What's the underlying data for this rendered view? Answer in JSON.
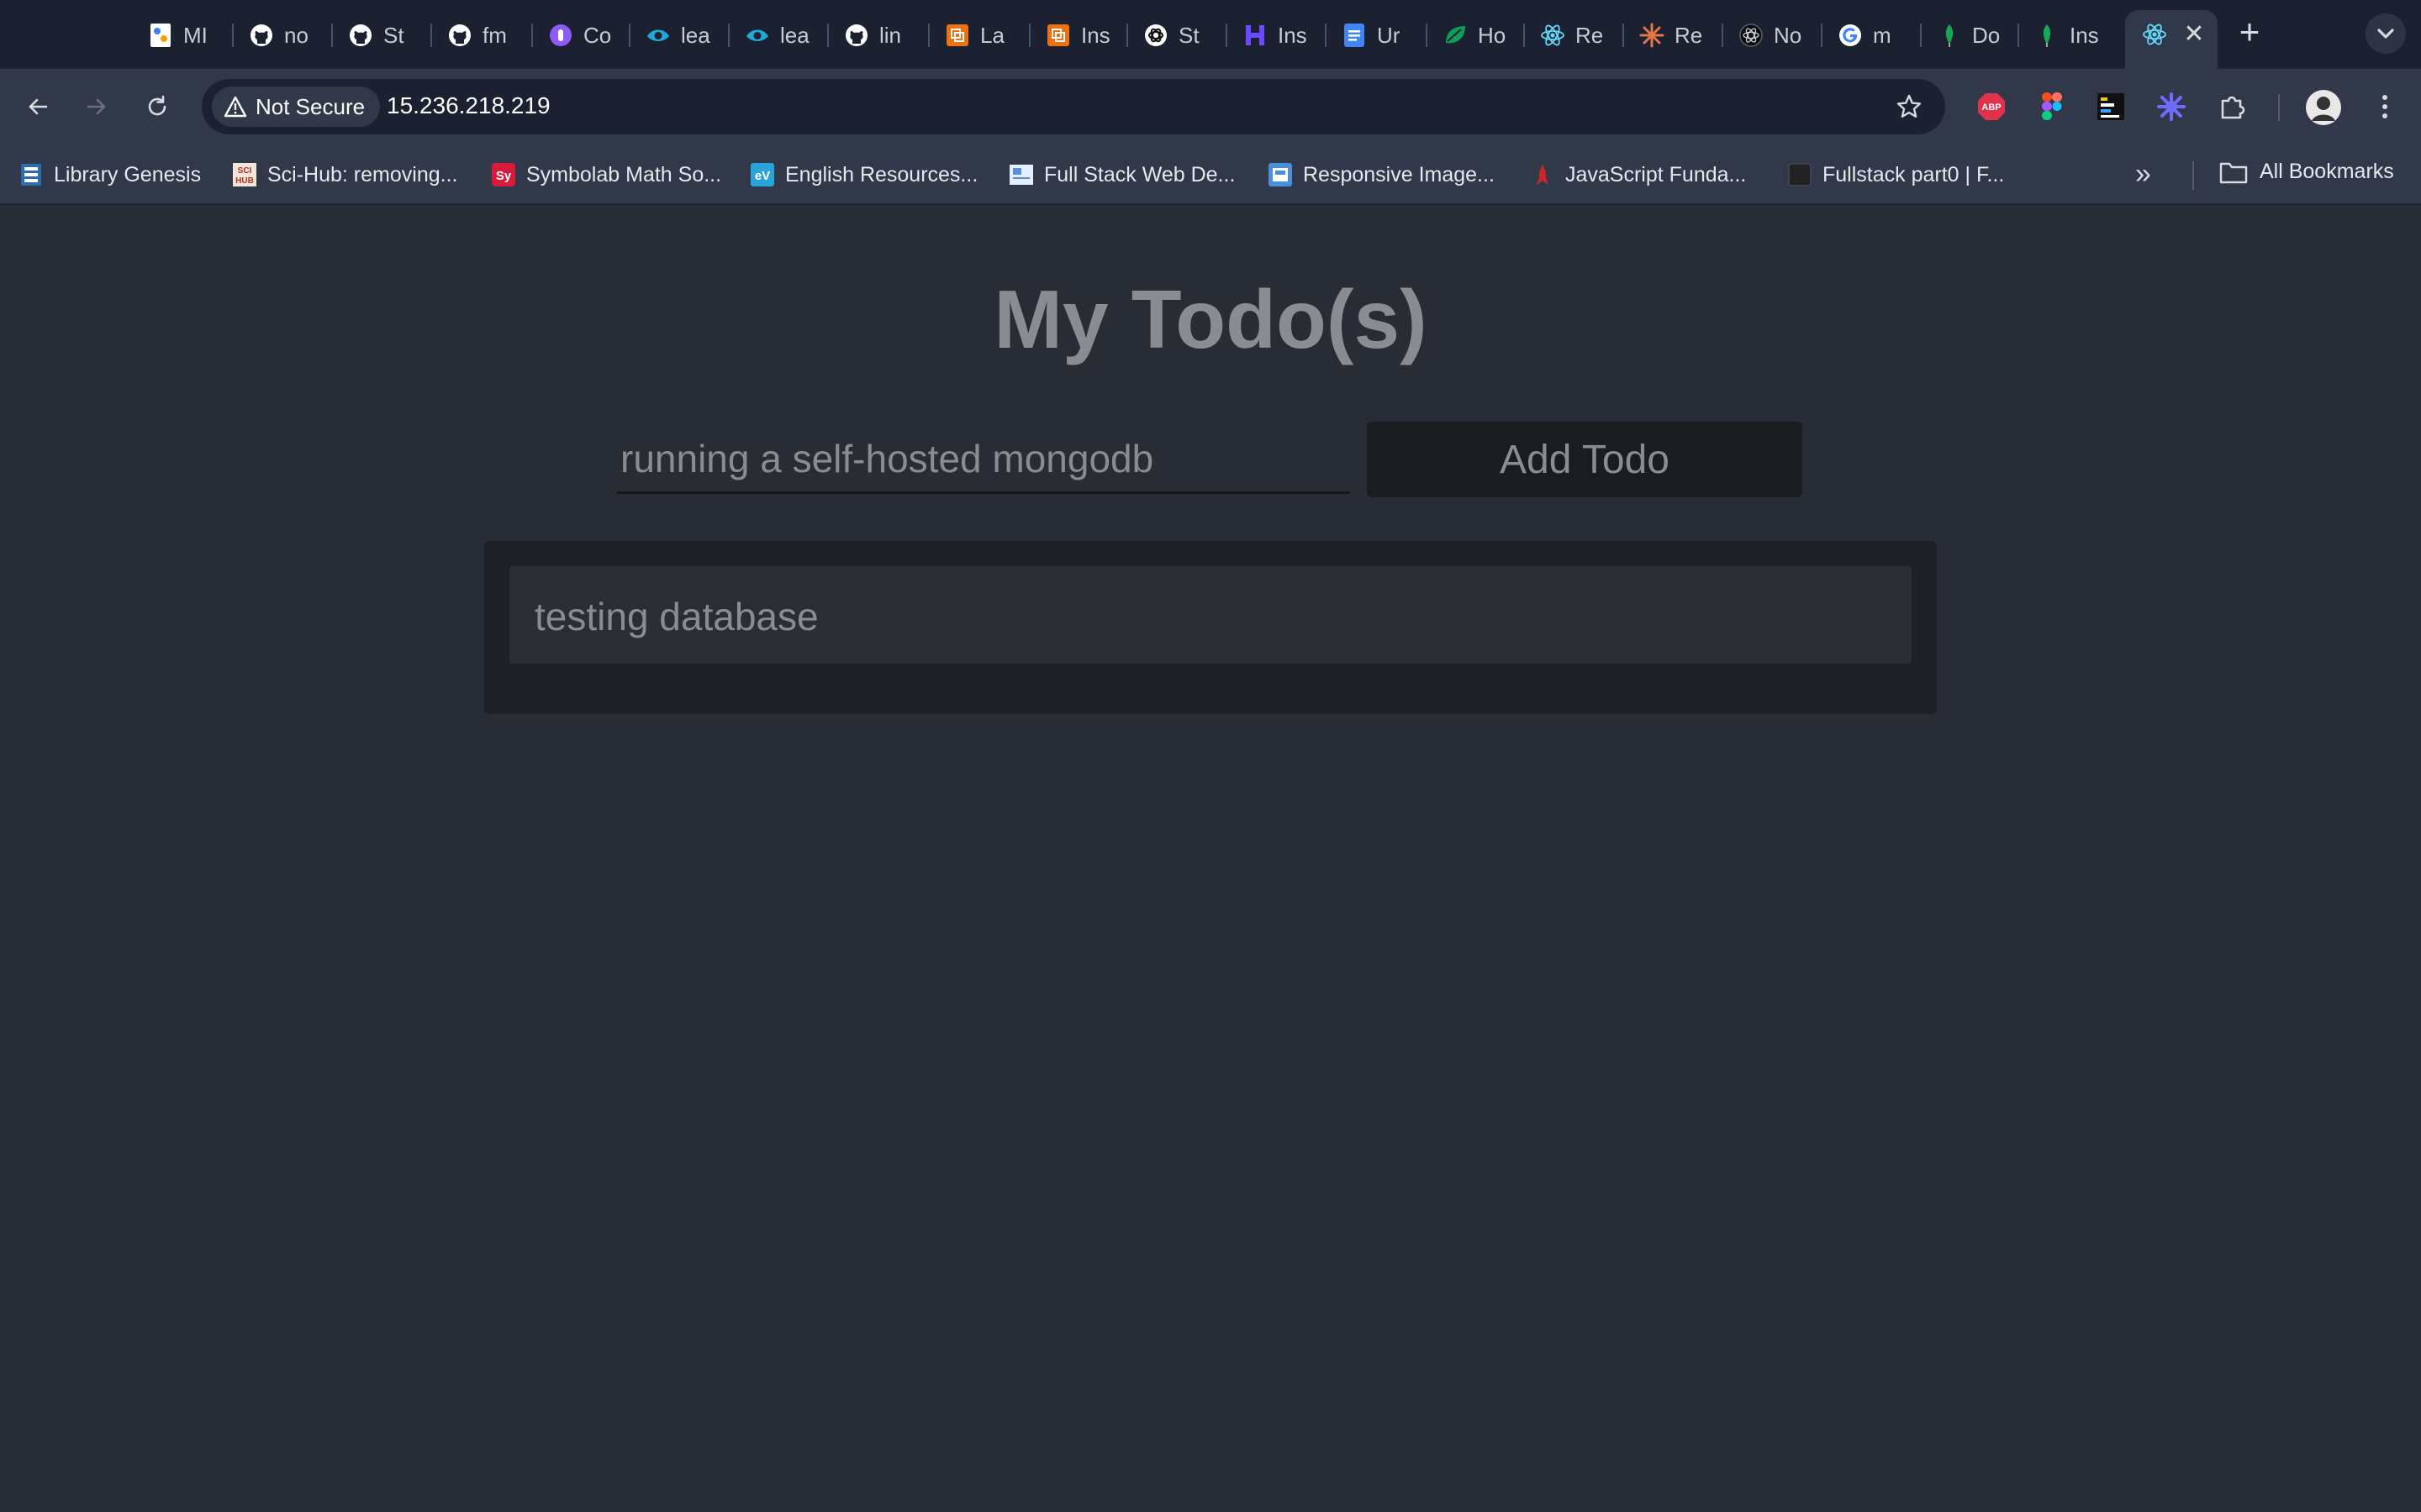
{
  "browser": {
    "tabs": [
      {
        "title": "MI",
        "icon": "ml-icon"
      },
      {
        "title": "no",
        "icon": "github-icon"
      },
      {
        "title": "St",
        "icon": "github-icon"
      },
      {
        "title": "fm",
        "icon": "github-icon"
      },
      {
        "title": "Co",
        "icon": "purple-circle-icon"
      },
      {
        "title": "lea",
        "icon": "eye-icon"
      },
      {
        "title": "lea",
        "icon": "eye-icon"
      },
      {
        "title": "lin",
        "icon": "github-icon"
      },
      {
        "title": "La",
        "icon": "aws-icon"
      },
      {
        "title": "Ins",
        "icon": "aws-icon"
      },
      {
        "title": "St",
        "icon": "openai-icon"
      },
      {
        "title": "Ins",
        "icon": "purple-h-icon"
      },
      {
        "title": "Ur",
        "icon": "docs-icon"
      },
      {
        "title": "Ho",
        "icon": "green-leaf-icon"
      },
      {
        "title": "Re",
        "icon": "react-icon"
      },
      {
        "title": "Re",
        "icon": "orange-burst-icon"
      },
      {
        "title": "No",
        "icon": "dark-atom-icon"
      },
      {
        "title": "m",
        "icon": "google-icon"
      },
      {
        "title": "Do",
        "icon": "mongodb-icon"
      },
      {
        "title": "Ins",
        "icon": "mongodb-icon"
      }
    ],
    "active_tab": {
      "icon": "react-icon",
      "close": "✕"
    },
    "new_tab": "+",
    "security": {
      "label": "Not Secure"
    },
    "url": "15.236.218.219",
    "extensions": [
      "abp-icon",
      "figma-icon",
      "chart-extension-icon",
      "star-burst-icon",
      "puzzle-icon"
    ],
    "bookmarks": [
      {
        "label": "Library Genesis",
        "icon": "libgen-icon",
        "color": "#2b6cb0"
      },
      {
        "label": "Sci-Hub: removing...",
        "icon": "scihub-icon",
        "color": "#b03030"
      },
      {
        "label": "Symbolab Math So...",
        "icon": "symbolab-icon",
        "color": "#d81b3c"
      },
      {
        "label": "English Resources...",
        "icon": "ev-icon",
        "color": "#27a4d8"
      },
      {
        "label": "Full Stack Web De...",
        "icon": "doc-thumb-icon",
        "color": "#9ac4f0"
      },
      {
        "label": "Responsive Image...",
        "icon": "web-icon",
        "color": "#4a90d9"
      },
      {
        "label": "JavaScript Funda...",
        "icon": "js-icon",
        "color": "#c62828"
      },
      {
        "label": "Fullstack part0 | F...",
        "icon": "fullstack-icon",
        "color": "#222222"
      }
    ],
    "bookmarks_more": "»",
    "all_bookmarks": "All Bookmarks"
  },
  "app": {
    "title": "My Todo(s)",
    "input": {
      "value": "running a self-hosted mongodb",
      "placeholder": ""
    },
    "add_button": "Add Todo",
    "todos": [
      {
        "text": "testing database"
      }
    ]
  }
}
